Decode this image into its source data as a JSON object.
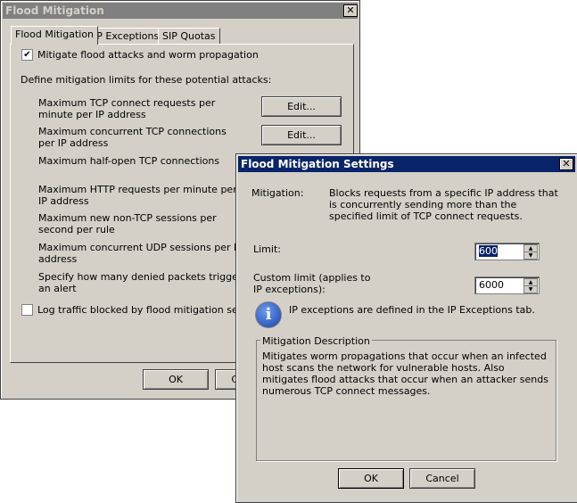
{
  "main_dialog": {
    "title": "Flood Mitigation",
    "tabs": [
      "Flood Mitigation",
      "IP Exceptions",
      "SIP Quotas"
    ],
    "mitigate_checkbox": {
      "label": "Mitigate flood attacks and worm propagation",
      "checked": true
    },
    "define_label": "Define mitigation limits for these potential attacks:",
    "limits": [
      "Maximum TCP connect requests per minute per IP address",
      "Maximum concurrent TCP connections per IP address",
      "Maximum half-open TCP connections",
      "Maximum HTTP requests per minute per IP address",
      "Maximum new non-TCP sessions per second per rule",
      "Maximum concurrent UDP sessions per IP address",
      "Specify how many denied packets trigger an alert"
    ],
    "edit_label": "Edit...",
    "log_checkbox": {
      "label": "Log traffic blocked by flood mitigation settings",
      "checked": false
    },
    "ok_label": "OK",
    "cancel_label": "Cancel"
  },
  "settings_dialog": {
    "title": "Flood Mitigation Settings",
    "mitigation_label": "Mitigation:",
    "mitigation_text": "Blocks requests from a specific IP address that is concurrently sending more than the specified limit of TCP connect requests.",
    "limit_label": "Limit:",
    "limit_value": "600",
    "custom_limit_label": "Custom limit (applies to IP exceptions):",
    "custom_limit_value": "6000",
    "info_text": "IP exceptions are defined in the IP Exceptions tab.",
    "description_group": "Mitigation Description",
    "description_text": "Mitigates worm propagations that occur when an infected host scans the network for vulnerable hosts. Also mitigates flood attacks that occur when an attacker sends numerous TCP connect messages.",
    "ok_label": "OK",
    "cancel_label": "Cancel"
  },
  "colors": {
    "active_title": "#0a246a",
    "inactive_title": "#808080",
    "face": "#d4d0c8"
  }
}
